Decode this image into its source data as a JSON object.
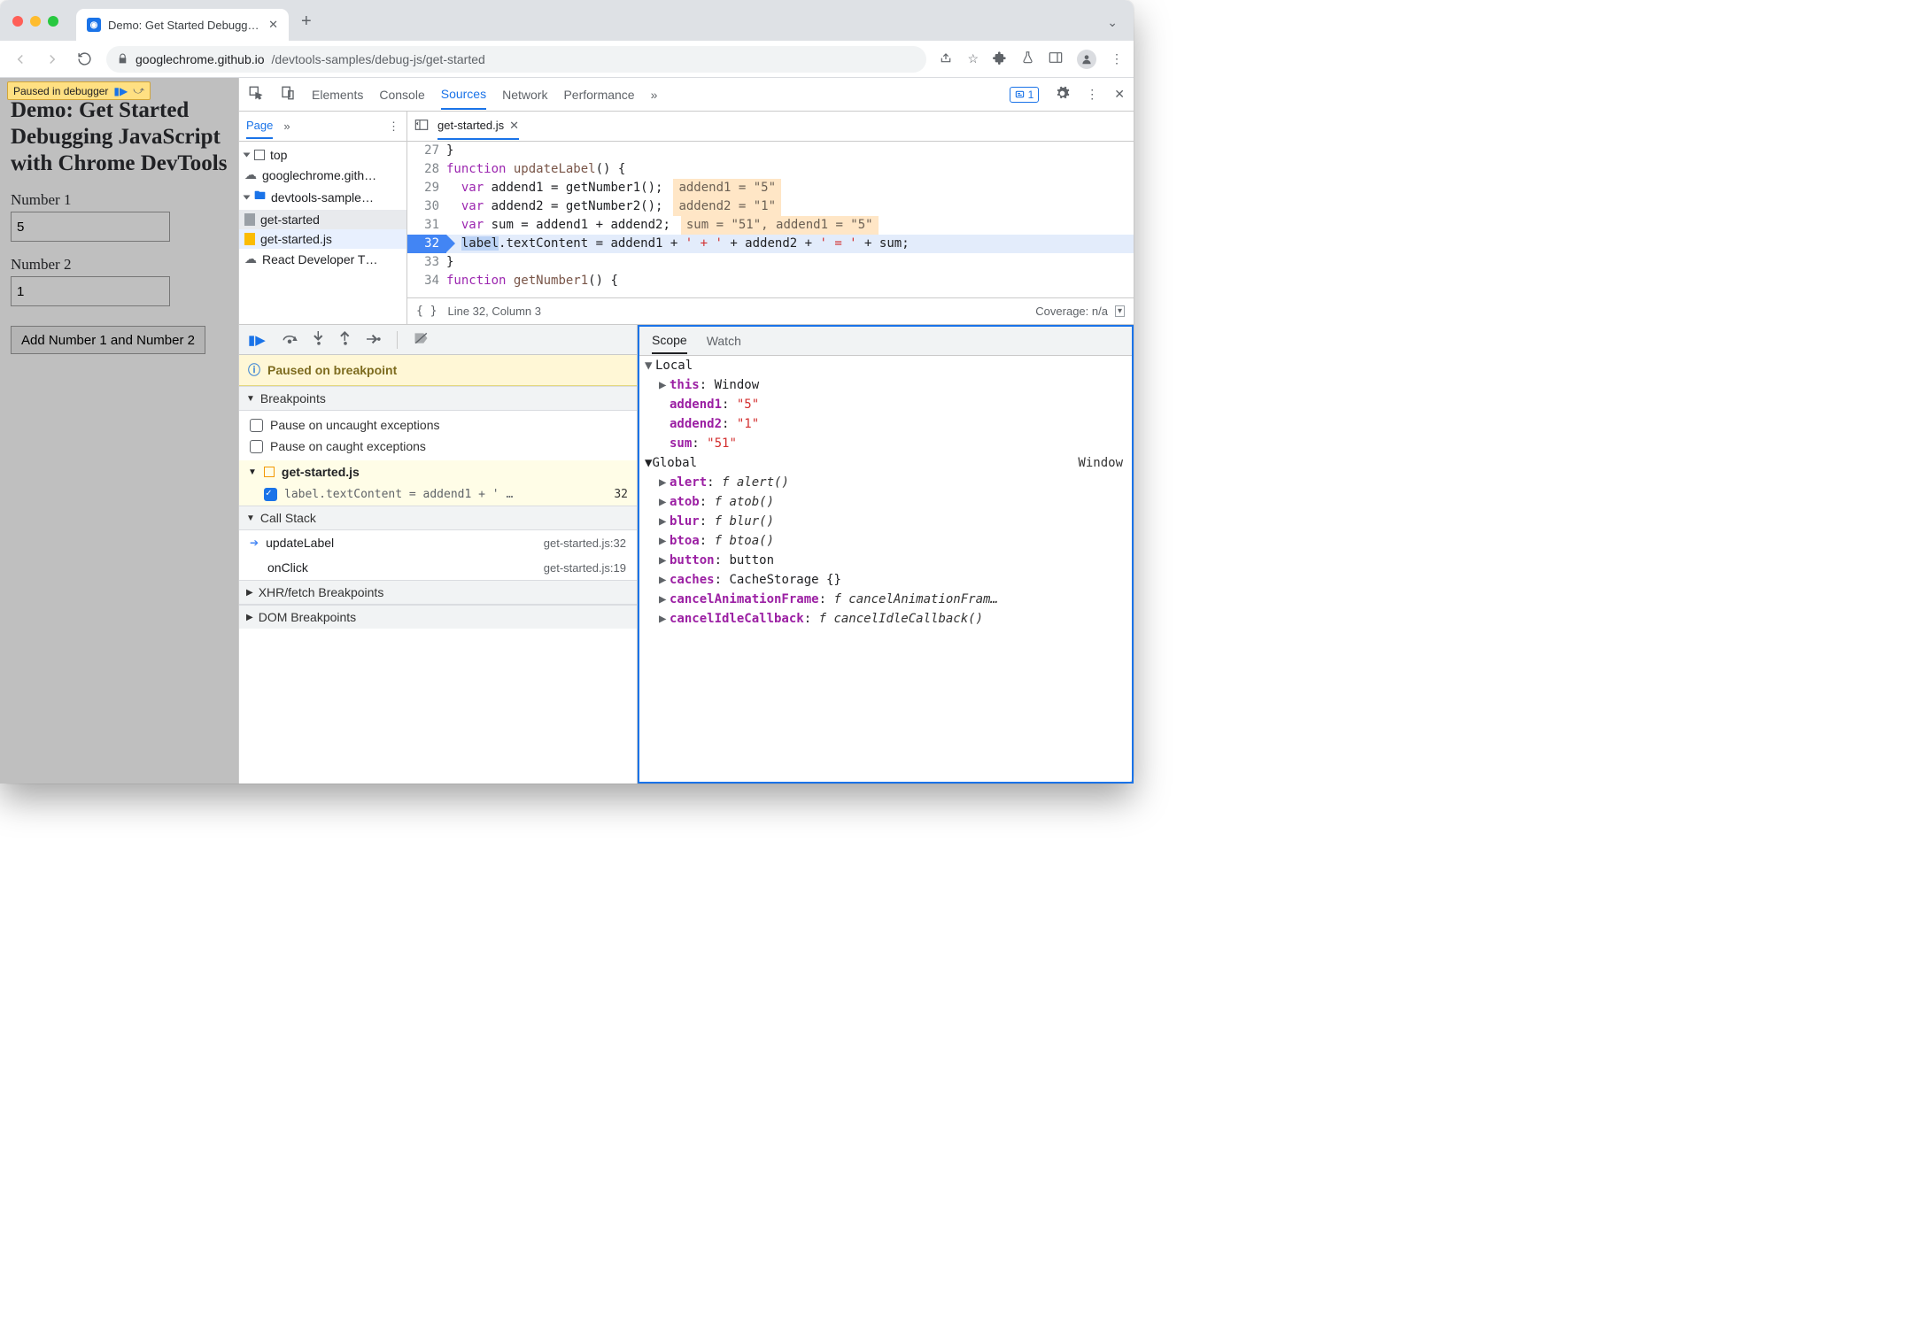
{
  "browser": {
    "tab_title": "Demo: Get Started Debugging",
    "url_host": "googlechrome.github.io",
    "url_path": "/devtools-samples/debug-js/get-started"
  },
  "page": {
    "overlay": "Paused in debugger",
    "title": "Demo: Get Started Debugging JavaScript with Chrome DevTools",
    "num1_label": "Number 1",
    "num1_value": "5",
    "num2_label": "Number 2",
    "num2_value": "1",
    "button": "Add Number 1 and Number 2"
  },
  "devtools": {
    "tabs": [
      "Elements",
      "Console",
      "Sources",
      "Network",
      "Performance"
    ],
    "active_tab": "Sources",
    "issue_count": "1",
    "nav": {
      "page_tab": "Page",
      "top": "top",
      "domain": "googlechrome.gith…",
      "folder": "devtools-sample…",
      "file_html": "get-started",
      "file_js": "get-started.js",
      "ext": "React Developer T…"
    },
    "source": {
      "filename": "get-started.js",
      "code": [
        {
          "n": 27,
          "t": "}"
        },
        {
          "n": 28,
          "html": "<span class='kw'>function</span> <span class='fn'>updateLabel</span>() {"
        },
        {
          "n": 29,
          "html": "&nbsp;&nbsp;<span class='kw'>var</span> addend1 = getNumber1();",
          "hint": "addend1 = \"5\""
        },
        {
          "n": 30,
          "html": "&nbsp;&nbsp;<span class='kw'>var</span> addend2 = getNumber2();",
          "hint": "addend2 = \"1\""
        },
        {
          "n": 31,
          "html": "&nbsp;&nbsp;<span class='kw'>var</span> sum = addend1 + addend2;",
          "hint": "sum = \"51\", addend1 = \"5\""
        },
        {
          "n": 32,
          "bp": true,
          "html": "&nbsp;&nbsp;<span class='hlspan'>label</span>.textContent = addend1 + <span class='str'>' + '</span> + addend2 + <span class='str'>' = '</span> + sum;"
        },
        {
          "n": 33,
          "t": "}"
        },
        {
          "n": 34,
          "html": "<span class='kw'>function</span> <span class='fn'>getNumber1</span>() {"
        }
      ],
      "status": "Line 32, Column 3",
      "coverage": "Coverage: n/a"
    },
    "debugger": {
      "paused": "Paused on breakpoint",
      "breakpoints_h": "Breakpoints",
      "uncaught": "Pause on uncaught exceptions",
      "caught": "Pause on caught exceptions",
      "bp_file": "get-started.js",
      "bp_item": "label.textContent = addend1 + ' …",
      "bp_line": "32",
      "callstack_h": "Call Stack",
      "stack": [
        {
          "fn": "updateLabel",
          "loc": "get-started.js:32",
          "cur": true
        },
        {
          "fn": "onClick",
          "loc": "get-started.js:19"
        }
      ],
      "xhr_h": "XHR/fetch Breakpoints",
      "dom_h": "DOM Breakpoints"
    },
    "scope": {
      "tabs": [
        "Scope",
        "Watch"
      ],
      "local_h": "Local",
      "local": [
        {
          "k": "this",
          "v": "Window",
          "t": "obj",
          "exp": true
        },
        {
          "k": "addend1",
          "v": "\"5\"",
          "t": "str"
        },
        {
          "k": "addend2",
          "v": "\"1\"",
          "t": "str"
        },
        {
          "k": "sum",
          "v": "\"51\"",
          "t": "str"
        }
      ],
      "global_h": "Global",
      "global_v": "Window",
      "global": [
        {
          "k": "alert",
          "v": "f alert()",
          "t": "fn"
        },
        {
          "k": "atob",
          "v": "f atob()",
          "t": "fn"
        },
        {
          "k": "blur",
          "v": "f blur()",
          "t": "fn"
        },
        {
          "k": "btoa",
          "v": "f btoa()",
          "t": "fn"
        },
        {
          "k": "button",
          "v": "button",
          "t": "obj"
        },
        {
          "k": "caches",
          "v": "CacheStorage {}",
          "t": "obj"
        },
        {
          "k": "cancelAnimationFrame",
          "v": "f cancelAnimationFram…",
          "t": "fn"
        },
        {
          "k": "cancelIdleCallback",
          "v": "f cancelIdleCallback()",
          "t": "fn"
        }
      ]
    }
  }
}
